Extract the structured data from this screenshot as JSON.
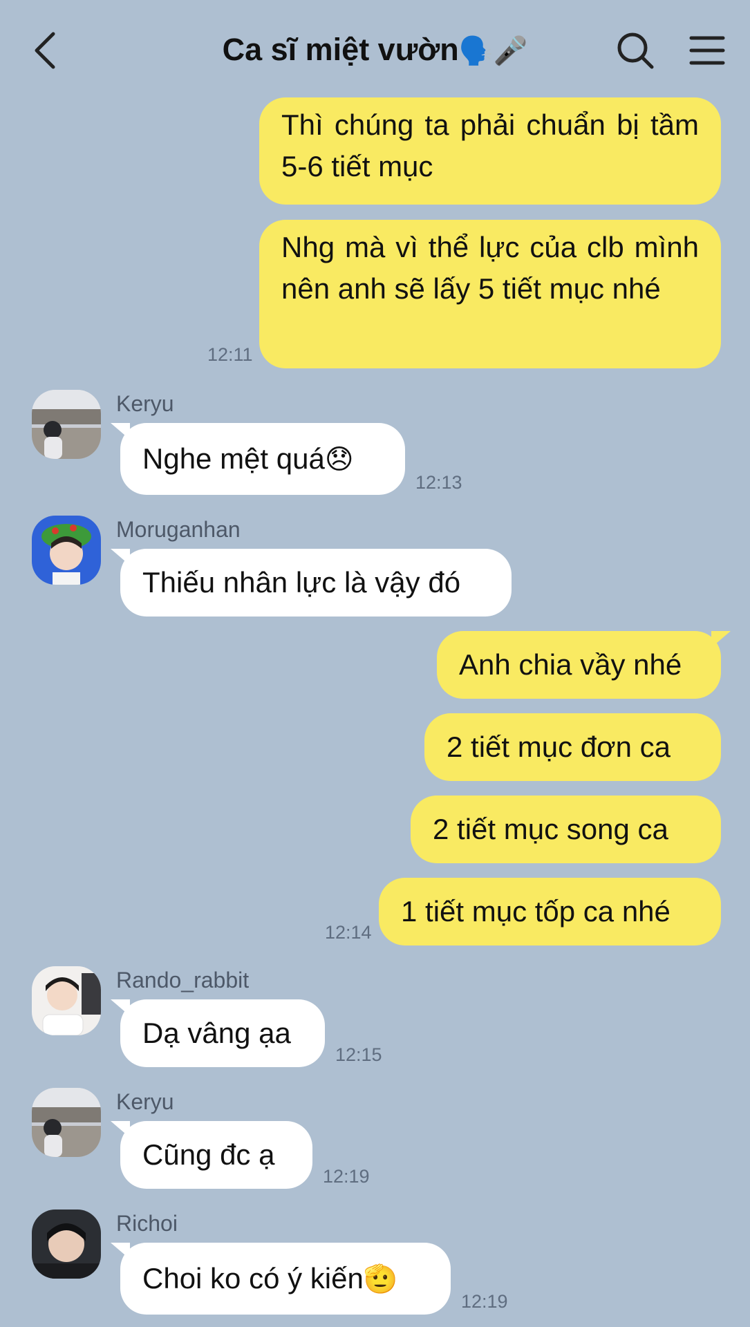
{
  "header": {
    "title": "Ca sĩ miệt vườn",
    "title_emojis": "🗣️🎤"
  },
  "messages": {
    "m1": {
      "text": "Thì chúng ta phải chuẩn bị tầm 5-6 tiết mục"
    },
    "m2": {
      "text": "Nhg mà vì thể lực của clb mình nên anh sẽ lấy 5 tiết mục nhé",
      "time": "12:11"
    },
    "m3": {
      "sender": "Keryu",
      "text": "Nghe mệt quá",
      "emoji": "😞",
      "time": "12:13"
    },
    "m4": {
      "sender": "Moruganhan",
      "text": "Thiếu nhân lực là vậy đó"
    },
    "m5": {
      "text": "Anh chia vầy nhé"
    },
    "m6": {
      "text": "2 tiết mục đơn ca"
    },
    "m7": {
      "text": "2 tiết mục song ca"
    },
    "m8": {
      "text": "1 tiết mục tốp ca nhé",
      "time": "12:14"
    },
    "m9": {
      "sender": "Rando_rabbit",
      "text": "Dạ vâng ạa",
      "time": "12:15"
    },
    "m10": {
      "sender": "Keryu",
      "text": "Cũng đc ạ",
      "time": "12:19"
    },
    "m11": {
      "sender": "Richoi",
      "text": "Choi ko có ý kiến",
      "emoji": "🫡",
      "time": "12:19"
    }
  },
  "icons": {
    "back": "chevron-left-icon",
    "search": "search-icon",
    "menu": "hamburger-menu-icon"
  },
  "colors": {
    "background": "#aebfd1",
    "outgoing_bubble": "#f9ea62",
    "incoming_bubble": "#ffffff"
  }
}
